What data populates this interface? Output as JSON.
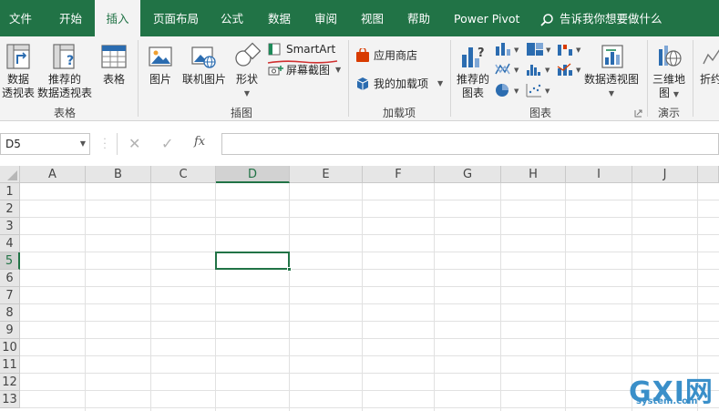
{
  "tabs": [
    {
      "label": "文件",
      "active": false
    },
    {
      "label": "开始",
      "active": false
    },
    {
      "label": "插入",
      "active": true
    },
    {
      "label": "页面布局",
      "active": false
    },
    {
      "label": "公式",
      "active": false
    },
    {
      "label": "数据",
      "active": false
    },
    {
      "label": "审阅",
      "active": false
    },
    {
      "label": "视图",
      "active": false
    },
    {
      "label": "帮助",
      "active": false
    },
    {
      "label": "Power Pivot",
      "active": false
    }
  ],
  "tell_me": "告诉我你想要做什么",
  "ribbon": {
    "groups": {
      "tables": "表格",
      "illustrations": "插图",
      "addins": "加载项",
      "charts": "图表",
      "tours": "演示"
    },
    "buttons": {
      "pivot_line1": "数据",
      "pivot_line2": "透视表",
      "rec_pivot_line1": "推荐的",
      "rec_pivot_line2": "数据透视表",
      "table": "表格",
      "pictures": "图片",
      "online_pictures": "联机图片",
      "shapes": "形状",
      "smartart": "SmartArt",
      "screenshot": "屏幕截图",
      "store": "应用商店",
      "my_addins": "我的加载项",
      "rec_charts_line1": "推荐的",
      "rec_charts_line2": "图表",
      "pivot_chart": "数据透视图",
      "map3d_line1": "三维地",
      "map3d_line2": "图",
      "cut_off": "折约"
    }
  },
  "formula_bar": {
    "name_box": "D5",
    "fx_label": "fx",
    "formula": ""
  },
  "sheet": {
    "columns": [
      "A",
      "B",
      "C",
      "D",
      "E",
      "F",
      "G",
      "H",
      "I",
      "J"
    ],
    "rows": [
      "1",
      "2",
      "3",
      "4",
      "5",
      "6",
      "7",
      "8",
      "9",
      "10",
      "11",
      "12",
      "13"
    ],
    "active_column": "D",
    "active_row": "5"
  },
  "watermark": {
    "text": "GXI网",
    "sub": "system.com"
  },
  "colors": {
    "accent": "#217346",
    "smartart_underline": "#d03030",
    "store_icon": "#d83b01",
    "addin_icon": "#2b6cb0"
  }
}
